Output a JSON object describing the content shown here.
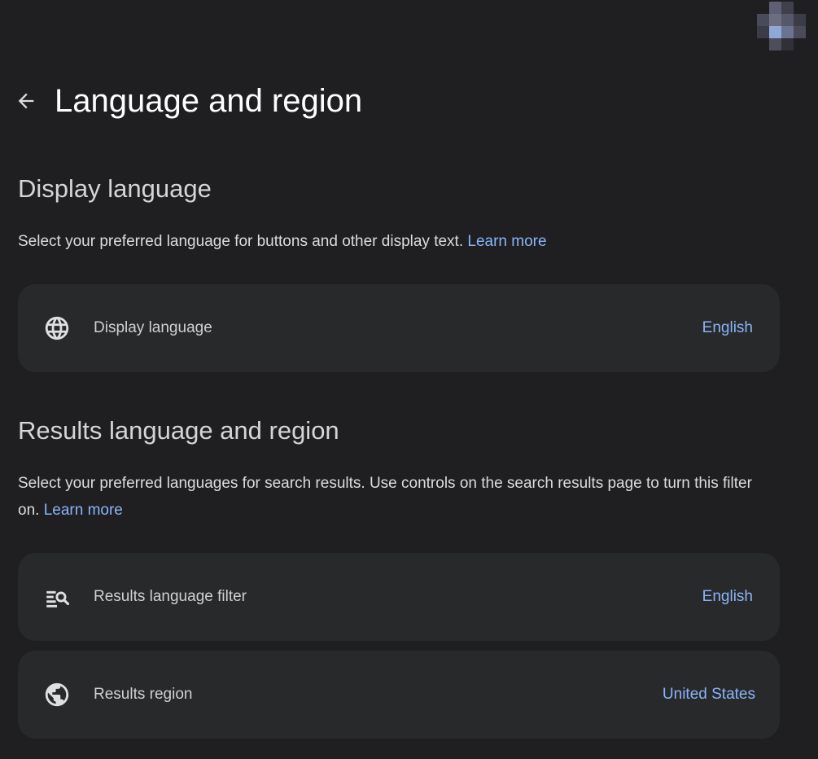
{
  "header": {
    "title": "Language and region",
    "back_icon": "arrow-back-icon"
  },
  "account": {
    "avatar_icon": "avatar-icon"
  },
  "display_section": {
    "title": "Display language",
    "description": "Select your preferred language for buttons and other display text.",
    "learn_more": "Learn more",
    "items": [
      {
        "icon": "globe-icon",
        "label": "Display language",
        "value": "English"
      }
    ]
  },
  "results_section": {
    "title": "Results language and region",
    "description": "Select your preferred languages for search results. Use controls on the search results page to turn this filter on.",
    "learn_more": "Learn more",
    "items": [
      {
        "icon": "search-filter-icon",
        "label": "Results language filter",
        "value": "English"
      },
      {
        "icon": "public-globe-icon",
        "label": "Results region",
        "value": "United States"
      }
    ]
  },
  "colors": {
    "background": "#1f1f21",
    "card": "#28292b",
    "link": "#8ab4f8",
    "title_text": "#ffffff"
  }
}
